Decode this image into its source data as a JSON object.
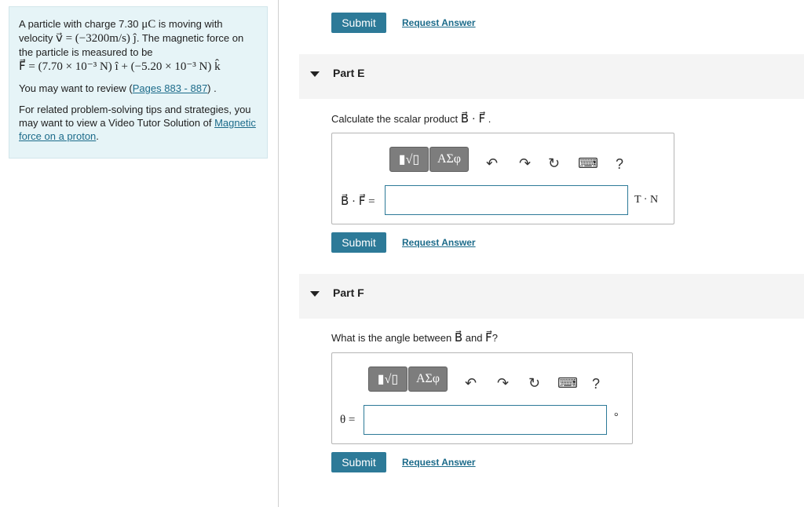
{
  "info": {
    "intro_prefix": "A particle with charge 7.30",
    "intro_unit": " μC",
    "intro_mid": " is moving with velocity ",
    "velocity_eq": "v⃗ = (−3200m/s) ĵ",
    "intro_suffix": ". The magnetic force on the particle is measured to be",
    "force_eq": "F⃗ = (7.70 × 10⁻³ N) î + (−5.20 × 10⁻³ N) k̂",
    "review_prefix": "You may want to review (",
    "review_link": "Pages 883 - 887",
    "review_suffix": ") .",
    "tips_text": "For related problem-solving tips and strategies, you may want to view a Video Tutor Solution of",
    "tips_link": "Magnetic force on a proton",
    "tips_suffix": "."
  },
  "top": {
    "submit_label": "Submit",
    "request_label": "Request Answer"
  },
  "part_e": {
    "title": "Part E",
    "question_prefix": "Calculate the scalar product ",
    "question_math": "B⃗ · F⃗",
    "question_suffix": " .",
    "answer_label": "B⃗ · F⃗ =",
    "answer_value": "",
    "unit": "T · N",
    "submit_label": "Submit",
    "request_label": "Request Answer"
  },
  "part_f": {
    "title": "Part F",
    "question_prefix": "What is the angle between ",
    "question_b": "B⃗",
    "question_mid": " and ",
    "question_f": "F⃗",
    "question_suffix": "?",
    "answer_label": "θ =",
    "answer_value": "",
    "unit": "°",
    "submit_label": "Submit",
    "request_label": "Request Answer"
  },
  "toolbar": {
    "template_label": "▮√▯",
    "symbols_label": "ΑΣφ",
    "undo_glyph": "↶",
    "redo_glyph": "↷",
    "reset_glyph": "↻",
    "keyboard_glyph": "⌨",
    "help_label": "?"
  },
  "colors": {
    "info_bg": "#e6f4f7",
    "accent": "#2d7a98",
    "link": "#1c6b8a",
    "header_bg": "#f4f4f4"
  }
}
